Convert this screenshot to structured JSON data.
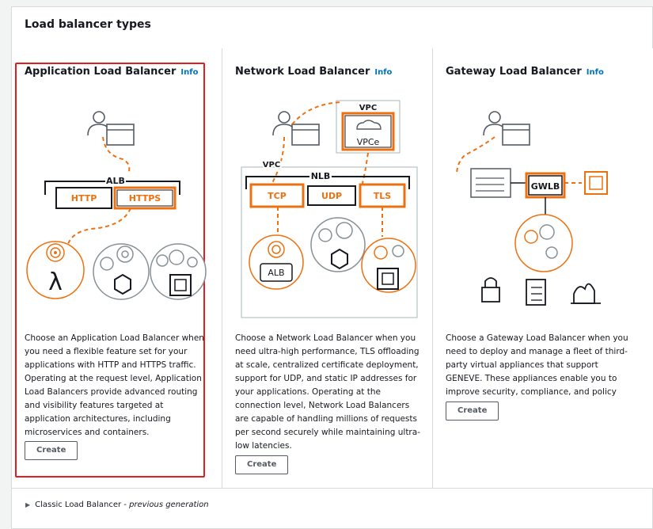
{
  "panel": {
    "title": "Load balancer types"
  },
  "cards": [
    {
      "title": "Application Load Balancer",
      "info": "Info",
      "diagram": {
        "group_label": "ALB",
        "protocols": [
          "HTTP",
          "HTTPS"
        ]
      },
      "description": "Choose an Application Load Balancer when you need a flexible feature set for your applications with HTTP and HTTPS traffic. Operating at the request level, Application Load Balancers provide advanced routing and visibility features targeted at application architectures, including microservices and containers.",
      "button": "Create",
      "selected": true
    },
    {
      "title": "Network Load Balancer",
      "info": "Info",
      "diagram": {
        "vpc_top": "VPC",
        "vpce": "VPCe",
        "vpc_left": "VPC",
        "group_label": "NLB",
        "protocols": [
          "TCP",
          "UDP",
          "TLS"
        ],
        "target": "ALB"
      },
      "description": "Choose a Network Load Balancer when you need ultra-high performance, TLS offloading at scale, centralized certificate deployment, support for UDP, and static IP addresses for your applications. Operating at the connection level, Network Load Balancers are capable of handling millions of requests per second securely while maintaining ultra-low latencies.",
      "button": "Create",
      "selected": false
    },
    {
      "title": "Gateway Load Balancer",
      "info": "Info",
      "diagram": {
        "group_label": "GWLB"
      },
      "description": "Choose a Gateway Load Balancer when you need to deploy and manage a fleet of third-party virtual appliances that support GENEVE. These appliances enable you to improve security, compliance, and policy controls.",
      "button": "Create",
      "selected": false
    }
  ],
  "classic": {
    "label": "Classic Load Balancer",
    "suffix": "previous generation"
  },
  "colors": {
    "accent": "#ec7211",
    "selected_border": "#e02020",
    "link": "#0073bb",
    "text": "#16191f"
  }
}
